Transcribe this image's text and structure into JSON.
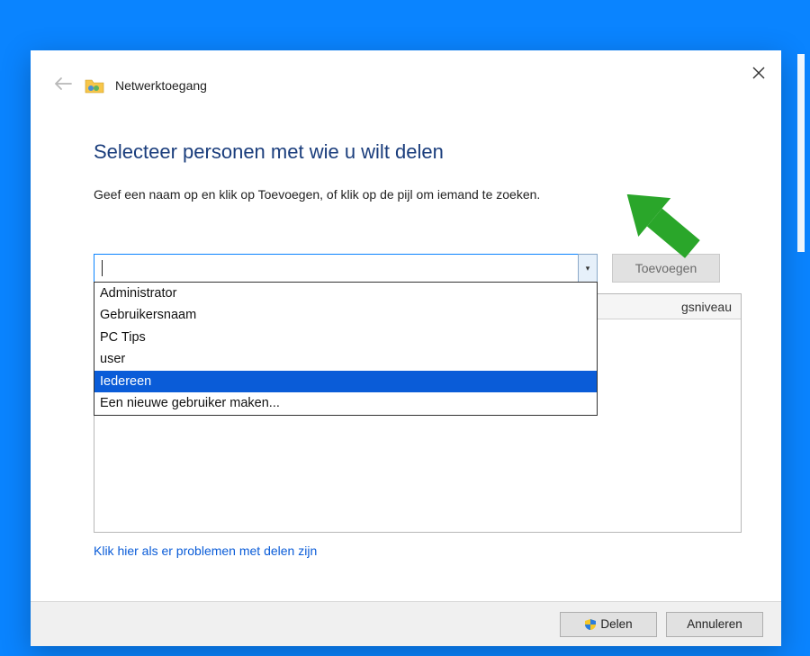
{
  "header": {
    "app_title": "Netwerktoegang"
  },
  "main": {
    "heading": "Selecteer personen met wie u wilt delen",
    "instruction": "Geef een naam op en klik op Toevoegen, of klik op de pijl om iemand te zoeken.",
    "input_value": "",
    "add_button": "Toevoegen",
    "dropdown": {
      "items": [
        "Administrator",
        "Gebruikersnaam",
        "PC Tips",
        "user",
        "Iedereen",
        "Een nieuwe gebruiker maken..."
      ],
      "selected_index": 4
    },
    "permission_header_fragment": "gsniveau",
    "problem_link": "Klik hier als er problemen met delen zijn"
  },
  "footer": {
    "share": "Delen",
    "cancel": "Annuleren"
  }
}
